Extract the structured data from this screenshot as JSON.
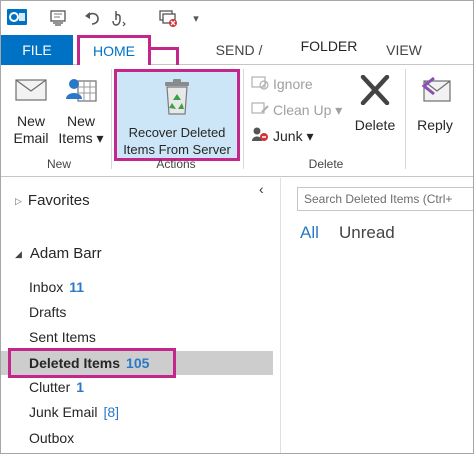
{
  "tabs": {
    "file": "FILE",
    "home": "HOME",
    "send_receive": "SEND / RECEIVE",
    "folder": "FOLDER",
    "view": "VIEW"
  },
  "ribbon": {
    "new_email_line1": "New",
    "new_email_line2": "Email",
    "new_items_line1": "New",
    "new_items_line2": "Items ▾",
    "new_group_label": "New",
    "recover_line1": "Recover Deleted",
    "recover_line2": "Items From Server",
    "actions_group_label": "Actions",
    "ignore": "Ignore",
    "clean_up": "Clean Up ▾",
    "junk": "Junk ▾",
    "delete": "Delete",
    "delete_group_label": "Delete",
    "reply": "Reply"
  },
  "folder_pane": {
    "favorites": "Favorites",
    "account": "Adam Barr",
    "folders": [
      {
        "name": "Inbox",
        "count": "11"
      },
      {
        "name": "Drafts",
        "count": ""
      },
      {
        "name": "Sent Items",
        "count": ""
      },
      {
        "name": "Deleted Items",
        "count": "105"
      },
      {
        "name": "Clutter",
        "count": "1"
      },
      {
        "name": "Junk Email",
        "count": "[8]"
      },
      {
        "name": "Outbox",
        "count": ""
      }
    ]
  },
  "message_list": {
    "search_placeholder": "Search Deleted Items (Ctrl+",
    "filter_all": "All",
    "filter_unread": "Unread"
  },
  "colors": {
    "accent": "#0072c6",
    "highlight": "#c4278b",
    "count_blue": "#2a78c8",
    "recover_bg": "#cde6f7"
  }
}
